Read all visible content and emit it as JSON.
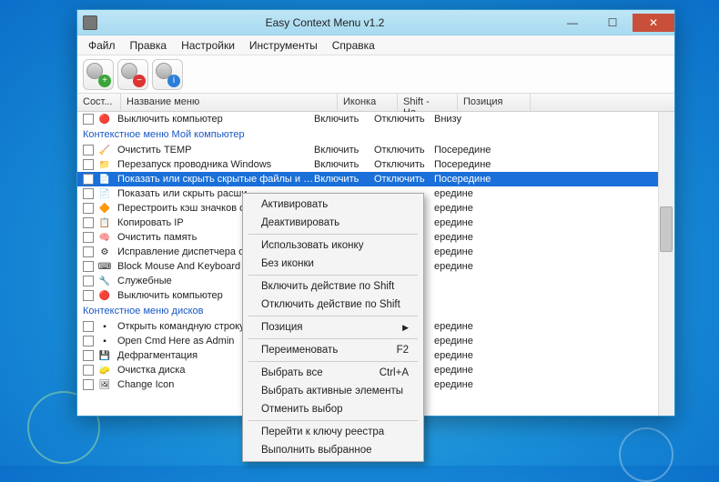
{
  "window": {
    "title": "Easy Context Menu v1.2"
  },
  "menubar": [
    "Файл",
    "Правка",
    "Настройки",
    "Инструменты",
    "Справка"
  ],
  "headers": {
    "state": "Сост...",
    "name": "Название меню",
    "icon": "Иконка",
    "shift": "Shift - На...",
    "pos": "Позиция"
  },
  "groups": [
    {
      "title": null,
      "rows": [
        {
          "icon": "🔴",
          "name": "Выключить компьютер",
          "c1": "Включить",
          "c2": "Отключить",
          "c3": "Внизу",
          "sel": false
        }
      ]
    },
    {
      "title": "Контекстное меню Мой компьютер",
      "rows": [
        {
          "icon": "🧹",
          "name": "Очистить TEMP",
          "c1": "Включить",
          "c2": "Отключить",
          "c3": "Посередине"
        },
        {
          "icon": "📁",
          "name": "Перезапуск проводника Windows",
          "c1": "Включить",
          "c2": "Отключить",
          "c3": "Посередине"
        },
        {
          "icon": "📄",
          "name": "Показать или скрыть скрытые файлы и папки",
          "c1": "Включить",
          "c2": "Отключить",
          "c3": "Посередине",
          "sel": true
        },
        {
          "icon": "📄",
          "name": "Показать или скрыть расши",
          "c1": "",
          "c2": "",
          "c3": "ередине"
        },
        {
          "icon": "🔶",
          "name": "Перестроить кэш значков о",
          "c1": "",
          "c2": "",
          "c3": "ередине"
        },
        {
          "icon": "📋",
          "name": "Копировать IP",
          "c1": "",
          "c2": "",
          "c3": "ередине"
        },
        {
          "icon": "🧠",
          "name": "Очистить память",
          "c1": "",
          "c2": "",
          "c3": "ередине"
        },
        {
          "icon": "⚙",
          "name": "Исправление диспетчера оч",
          "c1": "",
          "c2": "",
          "c3": "ередине"
        },
        {
          "icon": "⌨",
          "name": "Block Mouse And Keyboard",
          "c1": "",
          "c2": "",
          "c3": "ередине"
        },
        {
          "icon": "🔧",
          "name": "Служебные",
          "c1": "",
          "c2": "",
          "c3": ""
        },
        {
          "icon": "🔴",
          "name": "Выключить компьютер",
          "c1": "",
          "c2": "",
          "c3": ""
        }
      ]
    },
    {
      "title": "Контекстное меню дисков",
      "rows": [
        {
          "icon": "▪",
          "name": "Открыть командную строку",
          "c1": "",
          "c2": "",
          "c3": "ередине"
        },
        {
          "icon": "▪",
          "name": "Open Cmd Here as Admin",
          "c1": "",
          "c2": "",
          "c3": "ередине"
        },
        {
          "icon": "💾",
          "name": "Дефрагментация",
          "c1": "",
          "c2": "",
          "c3": "ередине"
        },
        {
          "icon": "🧽",
          "name": "Очистка диска",
          "c1": "",
          "c2": "",
          "c3": "ередине"
        },
        {
          "icon": "🖼",
          "name": "Change Icon",
          "c1": "",
          "c2": "",
          "c3": "ередине"
        }
      ]
    }
  ],
  "context_menu": {
    "items": [
      [
        {
          "label": "Активировать"
        },
        {
          "label": "Деактивировать"
        }
      ],
      [
        {
          "label": "Использовать иконку"
        },
        {
          "label": "Без иконки"
        }
      ],
      [
        {
          "label": "Включить действие по Shift"
        },
        {
          "label": "Отключить действие по Shift"
        }
      ],
      [
        {
          "label": "Позиция",
          "submenu": true
        }
      ],
      [
        {
          "label": "Переименовать",
          "shortcut": "F2"
        }
      ],
      [
        {
          "label": "Выбрать все",
          "shortcut": "Ctrl+A"
        },
        {
          "label": "Выбрать активные элементы"
        },
        {
          "label": "Отменить выбор"
        }
      ],
      [
        {
          "label": "Перейти к ключу реестра"
        },
        {
          "label": "Выполнить выбранное"
        }
      ]
    ]
  }
}
